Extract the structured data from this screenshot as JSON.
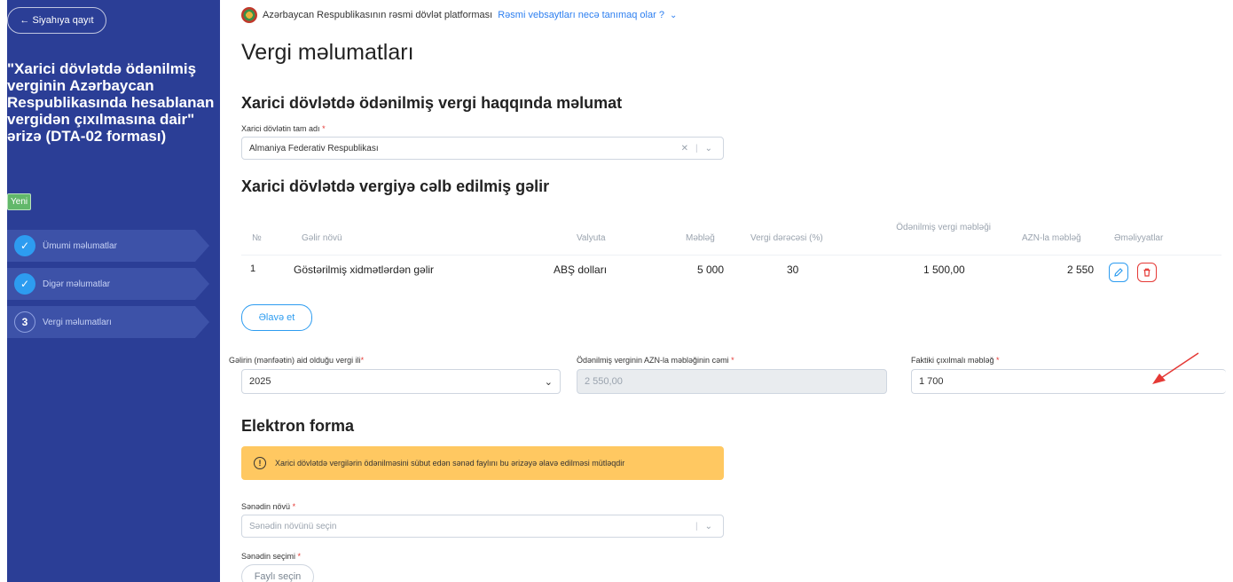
{
  "sidebar": {
    "back_label": "← Siyahıya qayıt",
    "title": "\"Xarici dövlətdə ödənilmiş verginin Azərbaycan Respublikasında hesablanan vergidən çıxılmasına dair\" ərizə (DTA-02 forması)",
    "badge": "Yeni",
    "steps": [
      {
        "mark": "✓",
        "label": "Ümumi məlumatlar"
      },
      {
        "mark": "✓",
        "label": "Digər məlumatlar"
      },
      {
        "mark": "3",
        "label": "Vergi məlumatları"
      }
    ]
  },
  "banner": {
    "text": "Azərbaycan Respublikasının rəsmi dövlət platforması",
    "link": "Rəsmi vebsaytları necə tanımaq olar ?"
  },
  "page_title": "Vergi məlumatları",
  "section1": {
    "title": "Xarici dövlətdə ödənilmiş vergi haqqında məlumat",
    "country_label": "Xarici dövlətin tam adı",
    "country_value": "Almaniya Federativ Respublikası"
  },
  "section2": {
    "title": "Xarici dövlətdə vergiyə cəlb edilmiş gəlir",
    "columns": [
      "№",
      "Gəlir növü",
      "Valyuta",
      "Məbləğ",
      "Vergi dərəcəsi (%)",
      "Ödənilmiş vergi məbləği",
      "AZN-la məbləğ",
      "Əməliyyatlar"
    ],
    "rows": [
      {
        "no": "1",
        "type": "Göstərilmiş xidmətlərdən gəlir",
        "currency": "ABŞ dolları",
        "amount": "5 000",
        "rate": "30",
        "paid": "1 500,00",
        "azn": "2 550"
      }
    ],
    "add_label": "Əlavə et"
  },
  "fields": {
    "year_label": "Gəlirin (mənfəətin) aid olduğu vergi ili",
    "year_value": "2025",
    "sum_label": "Ödənilmiş verginin AZN-la məbləğinin cəmi",
    "sum_value": "2 550,00",
    "actual_label": "Faktiki çıxılmalı məbləğ",
    "actual_value": "1 700"
  },
  "section3": {
    "title": "Elektron forma",
    "alert": "Xarici dövlətdə vergilərin ödənilməsini sübut edən sənəd faylını bu ərizəyə əlavə edilməsi mütləqdir",
    "doc_type_label": "Sənədin növü",
    "doc_type_placeholder": "Sənədin növünü seçin",
    "doc_select_label": "Sənədin seçimi",
    "file_button": "Faylı seçin"
  },
  "colors": {
    "sidebar": "#2b3e96",
    "accent": "#2d9cf0",
    "alert": "#ffc861",
    "danger": "#e53935"
  }
}
